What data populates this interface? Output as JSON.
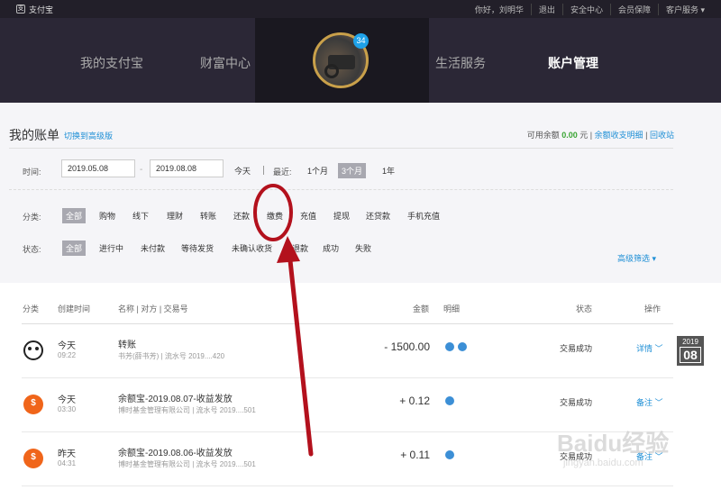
{
  "topbar": {
    "brand": "支付宝",
    "links": [
      "你好，刘明华",
      "退出",
      "安全中心",
      "会员保障",
      "客户服务 ▾"
    ]
  },
  "nav": {
    "items": [
      "我的支付宝",
      "财富中心",
      "生活服务",
      "账户管理"
    ],
    "badge": "34"
  },
  "bill": {
    "title": "我的账单",
    "switch_link": "切换到高级版",
    "balance_label": "可用余额",
    "balance_amount": "0.00",
    "balance_unit": "元",
    "detail_link": "余额收支明细",
    "recycle_link": "回收站"
  },
  "filter": {
    "time_label": "时间:",
    "start_date": "2019.05.08",
    "end_date": "2019.08.08",
    "today": "今天",
    "recent_label": "最近:",
    "ranges": [
      "1个月",
      "3个月",
      "1年"
    ],
    "category_label": "分类:",
    "categories": [
      "全部",
      "购物",
      "线下",
      "理财",
      "转账",
      "还款",
      "缴费",
      "充值",
      "提现",
      "还贷款",
      "手机充值"
    ],
    "status_label": "状态:",
    "statuses": [
      "全部",
      "进行中",
      "未付款",
      "等待发货",
      "未确认收货",
      "退款",
      "成功",
      "失败"
    ],
    "advanced": "高级筛选 ▾"
  },
  "table": {
    "headers": [
      "分类",
      "创建时间",
      "名称 | 对方 | 交易号",
      "金额",
      "明细",
      "状态",
      "操作"
    ],
    "rows": [
      {
        "day": "今天",
        "time": "09:22",
        "name": "转账",
        "sub": "书芳(薛书芳) | 流水号 2019....420",
        "amount": "- 1500.00",
        "status": "交易成功",
        "op": "详情 ﹀"
      },
      {
        "day": "今天",
        "time": "03:30",
        "name": "余额宝-2019.08.07-收益发放",
        "sub": "博时基金管理有限公司 | 流水号 2019....501",
        "amount": "+ 0.12",
        "status": "交易成功",
        "op": "备注 ﹀"
      },
      {
        "day": "昨天",
        "time": "04:31",
        "name": "余额宝-2019.08.06-收益发放",
        "sub": "博时基金管理有限公司 | 流水号 2019....501",
        "amount": "+ 0.11",
        "status": "交易成功",
        "op": "备注 ﹀"
      }
    ]
  },
  "yearbox": {
    "year": "2019",
    "month": "08"
  },
  "watermark": {
    "text": "Baidu经验",
    "url": "jingyan.baidu.com"
  },
  "colors": {
    "accent": "#1e8fd6",
    "annotation": "#b3111d",
    "balance": "#3aa534"
  }
}
